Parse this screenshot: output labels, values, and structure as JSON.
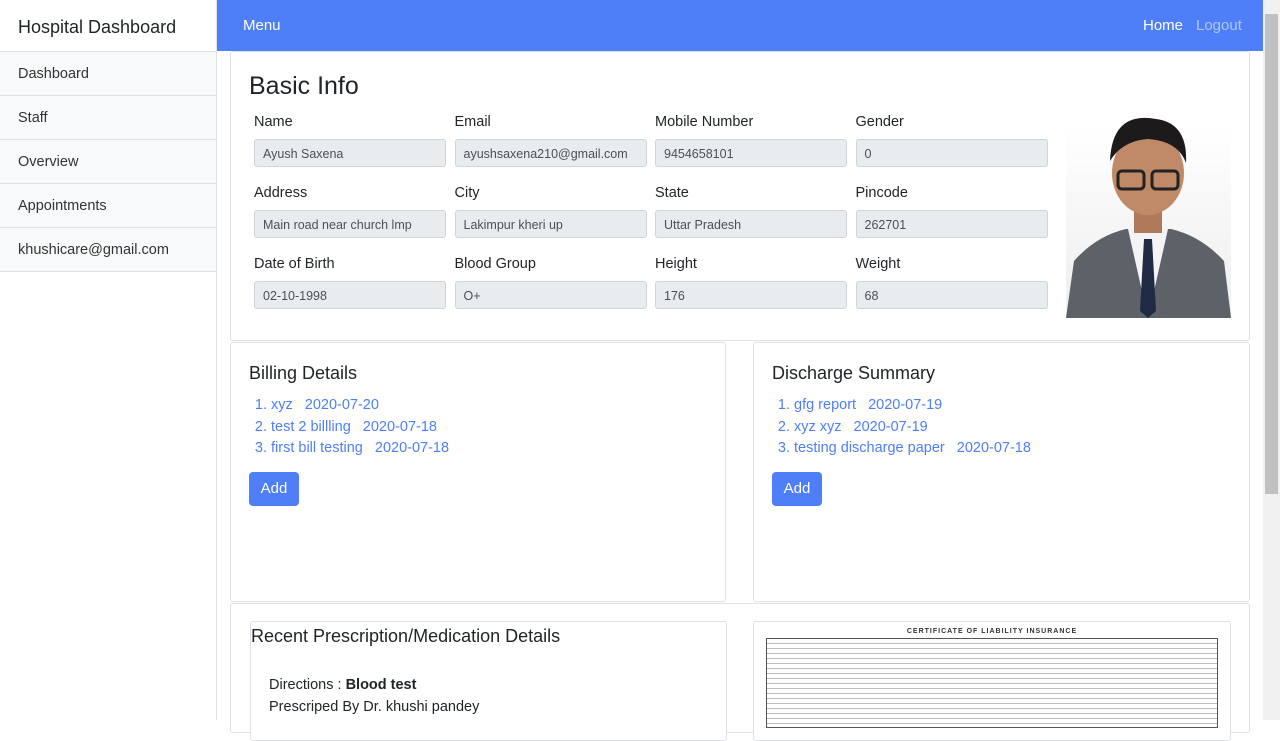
{
  "sidebar": {
    "brand": "Hospital Dashboard",
    "items": [
      "Dashboard",
      "Staff",
      "Overview",
      "Appointments",
      "khushicare@gmail.com"
    ]
  },
  "topbar": {
    "menu": "Menu",
    "home": "Home",
    "logout": "Logout"
  },
  "basic_info": {
    "title": "Basic Info",
    "fields": [
      {
        "label": "Name",
        "value": "Ayush Saxena"
      },
      {
        "label": "Email",
        "value": "ayushsaxena210@gmail.com"
      },
      {
        "label": "Mobile Number",
        "value": "9454658101"
      },
      {
        "label": "Gender",
        "value": "0"
      },
      {
        "label": "Address",
        "value": "Main road near church lmp"
      },
      {
        "label": "City",
        "value": "Lakimpur kheri up"
      },
      {
        "label": "State",
        "value": "Uttar Pradesh"
      },
      {
        "label": "Pincode",
        "value": "262701"
      },
      {
        "label": "Date of Birth",
        "value": "02-10-1998"
      },
      {
        "label": "Blood Group",
        "value": "O+"
      },
      {
        "label": "Height",
        "value": "176"
      },
      {
        "label": "Weight",
        "value": "68"
      }
    ]
  },
  "billing": {
    "title": "Billing Details",
    "items": [
      {
        "name": "xyz",
        "date": "2020-07-20"
      },
      {
        "name": "test 2 billling",
        "date": "2020-07-18"
      },
      {
        "name": "first bill testing",
        "date": "2020-07-18"
      }
    ],
    "add": "Add"
  },
  "discharge": {
    "title": "Discharge Summary",
    "items": [
      {
        "name": "gfg report",
        "date": "2020-07-19"
      },
      {
        "name": "xyz xyz",
        "date": "2020-07-19"
      },
      {
        "name": "testing discharge paper",
        "date": "2020-07-18"
      }
    ],
    "add": "Add"
  },
  "prescription": {
    "title": "Recent Prescription/Medication Details",
    "directions_label": "Directions : ",
    "directions": "Blood test",
    "prescribed_by": "Prescriped By Dr. khushi pandey",
    "document_heading": "CERTIFICATE OF LIABILITY INSURANCE"
  },
  "colors": {
    "primary": "#4e7ff8"
  }
}
